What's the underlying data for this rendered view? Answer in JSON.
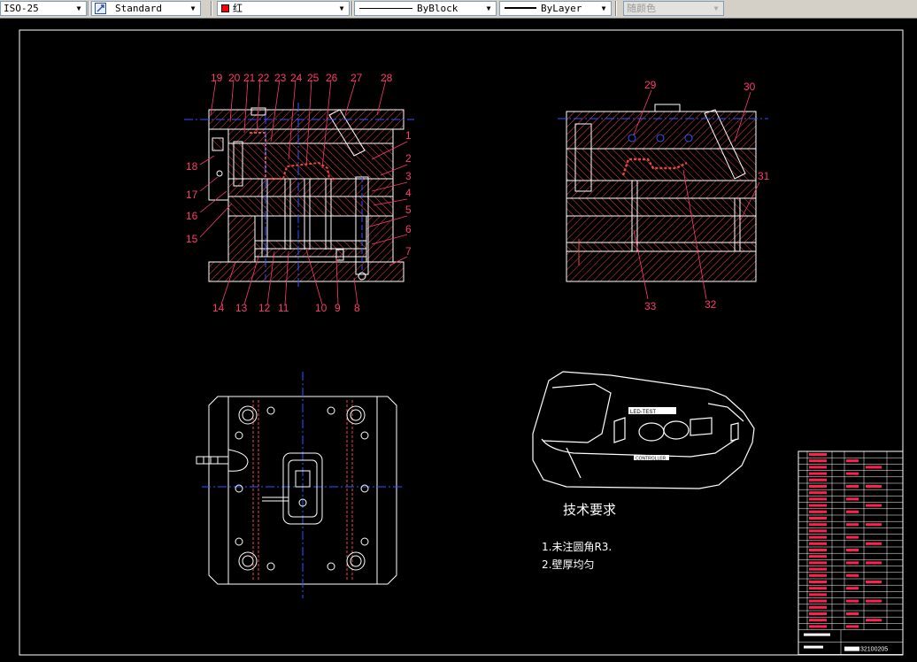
{
  "toolbar": {
    "dimstyle": "ISO-25",
    "textstyle": "Standard",
    "layer": "红",
    "linetype": "ByBlock",
    "lineweight": "ByLayer",
    "plotstyle": "随颜色"
  },
  "colors": {
    "background": "#000000",
    "hatch": "#e84a3a",
    "outline": "#ffffff",
    "centerline": "#3355ff",
    "label": "#ff3b6b",
    "part": "#ffffff"
  },
  "drawing": {
    "section_a_labels": [
      "19",
      "20",
      "21",
      "22",
      "23",
      "24",
      "25",
      "26",
      "27",
      "28",
      "1",
      "2",
      "3",
      "4",
      "5",
      "6",
      "7",
      "8",
      "9",
      "10",
      "11",
      "12",
      "13",
      "14",
      "15",
      "16",
      "17",
      "18"
    ],
    "section_b_labels": [
      "29",
      "30",
      "31",
      "32",
      "33"
    ],
    "tech_title": "技术要求",
    "tech_items": [
      "1.未注圆角R3.",
      "2.壁厚均匀"
    ],
    "part_badge_top": "LED-TEST",
    "part_badge_bottom": "CONTROLLER",
    "drawing_number": "32100205"
  }
}
